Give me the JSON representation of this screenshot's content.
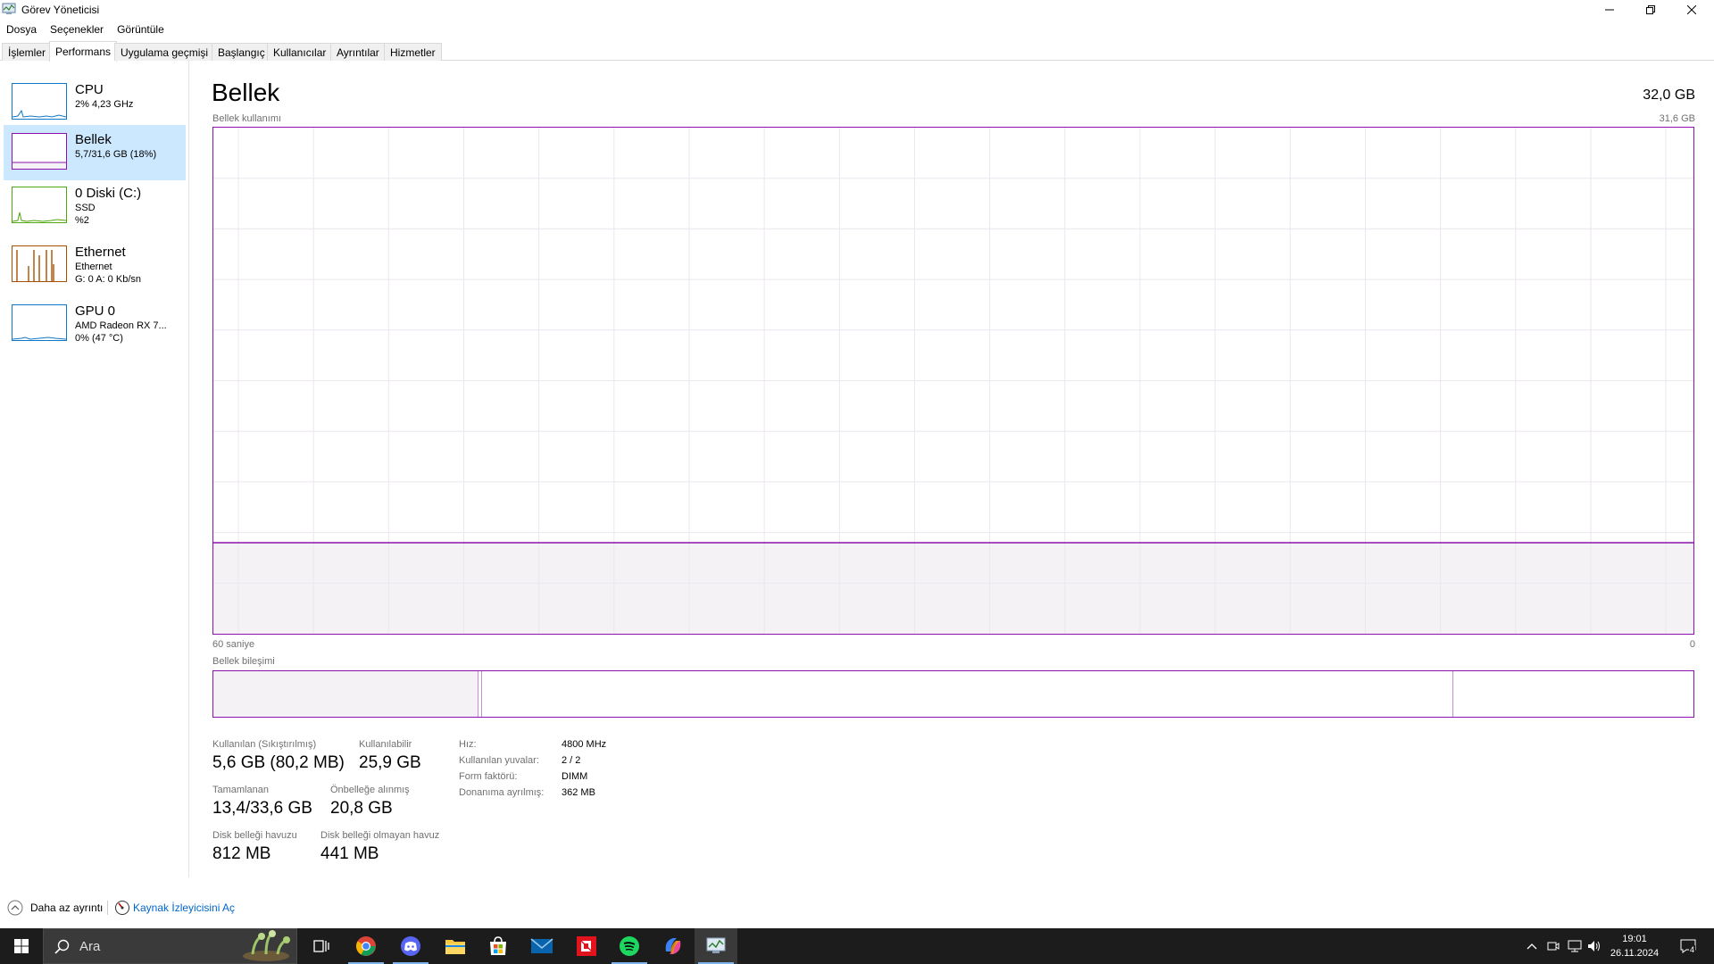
{
  "window": {
    "title": "Görev Yöneticisi"
  },
  "menu": [
    "Dosya",
    "Seçenekler",
    "Görüntüle"
  ],
  "tabs": [
    "İşlemler",
    "Performans",
    "Uygulama geçmişi",
    "Başlangıç",
    "Kullanıcılar",
    "Ayrıntılar",
    "Hizmetler"
  ],
  "active_tab": "Performans",
  "sidebar": [
    {
      "title": "CPU",
      "sub1": "2% 4,23 GHz",
      "sub2": "",
      "color": "#1178c8"
    },
    {
      "title": "Bellek",
      "sub1": "5,7/31,6 GB (18%)",
      "sub2": "",
      "color": "#8b12ae",
      "selected": true
    },
    {
      "title": "0 Diski (C:)",
      "sub1": "SSD",
      "sub2": "%2",
      "color": "#4da60c"
    },
    {
      "title": "Ethernet",
      "sub1": "Ethernet",
      "sub2": "G: 0 A: 0 Kb/sn",
      "color": "#a74f01"
    },
    {
      "title": "GPU 0",
      "sub1": "AMD Radeon RX 7...",
      "sub2": "0% (47 °C)",
      "color": "#1178c8"
    }
  ],
  "memory": {
    "title": "Bellek",
    "total": "32,0 GB",
    "usage_label": "Bellek kullanımı",
    "usage_max": "31,6 GB",
    "x_left": "60 saniye",
    "x_right": "0",
    "composition_label": "Bellek bileşimi",
    "usage_fraction": 0.18,
    "stats": {
      "in_use_label": "Kullanılan (Sıkıştırılmış)",
      "in_use": "5,6 GB (80,2 MB)",
      "available_label": "Kullanılabilir",
      "available": "25,9 GB",
      "committed_label": "Tamamlanan",
      "committed": "13,4/33,6 GB",
      "cached_label": "Önbelleğe alınmış",
      "cached": "20,8 GB",
      "paged_label": "Disk belleği havuzu",
      "paged": "812 MB",
      "nonpaged_label": "Disk belleği olmayan havuz",
      "nonpaged": "441 MB"
    },
    "details": [
      {
        "label": "Hız:",
        "value": "4800 MHz"
      },
      {
        "label": "Kullanılan yuvalar:",
        "value": "2 / 2"
      },
      {
        "label": "Form faktörü:",
        "value": "DIMM"
      },
      {
        "label": "Donanıma ayrılmış:",
        "value": "362 MB"
      }
    ]
  },
  "footer": {
    "fewer_details": "Daha az ayrıntı",
    "open_resmon": "Kaynak İzleyicisini Aç"
  },
  "taskbar": {
    "search_placeholder": "Ara",
    "apps": [
      "task-view",
      "chrome",
      "discord",
      "file-explorer",
      "microsoft-store",
      "mail",
      "amd-software",
      "spotify",
      "copilot",
      "task-manager"
    ],
    "time": "19:01",
    "date": "26.11.2024",
    "notification_count": "4"
  }
}
